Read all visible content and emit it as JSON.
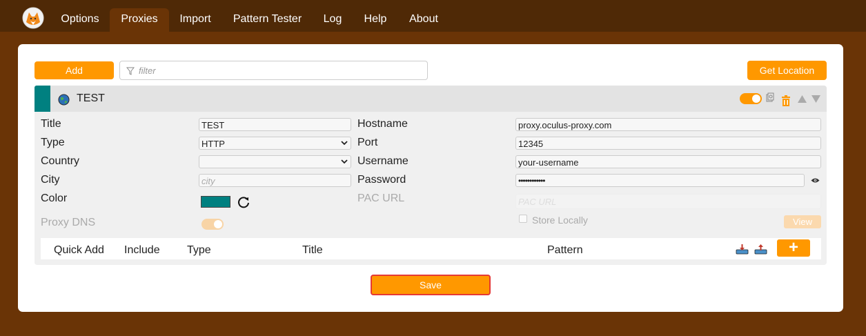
{
  "nav": {
    "tabs": [
      {
        "label": "Options"
      },
      {
        "label": "Proxies"
      },
      {
        "label": "Import"
      },
      {
        "label": "Pattern Tester"
      },
      {
        "label": "Log"
      },
      {
        "label": "Help"
      },
      {
        "label": "About"
      }
    ],
    "active": "Proxies"
  },
  "toolbar": {
    "add_label": "Add",
    "filter_placeholder": "filter",
    "get_location_label": "Get Location"
  },
  "proxy": {
    "title": "TEST",
    "enabled": true,
    "color": "#008080",
    "fields": {
      "title_label": "Title",
      "title_value": "TEST",
      "type_label": "Type",
      "type_value": "HTTP",
      "country_label": "Country",
      "country_value": "",
      "city_label": "City",
      "city_placeholder": "city",
      "color_label": "Color",
      "proxy_dns_label": "Proxy DNS",
      "hostname_label": "Hostname",
      "hostname_value": "proxy.oculus-proxy.com",
      "port_label": "Port",
      "port_value": "12345",
      "username_label": "Username",
      "username_value": "your-username",
      "password_label": "Password",
      "password_value": "••••••••••••",
      "pac_url_label": "PAC URL",
      "pac_url_placeholder": "PAC URL",
      "store_locally_label": "Store Locally",
      "view_label": "View"
    },
    "rules_columns": [
      "Quick Add",
      "Include",
      "Type",
      "Title",
      "Pattern"
    ],
    "add_rule_label": "+"
  },
  "footer": {
    "save_label": "Save"
  },
  "colors": {
    "accent": "#ff9800",
    "nav_bg": "#4f2906",
    "page_bg": "#6a3406",
    "proxy_color": "#008080",
    "save_border": "#e53935"
  }
}
